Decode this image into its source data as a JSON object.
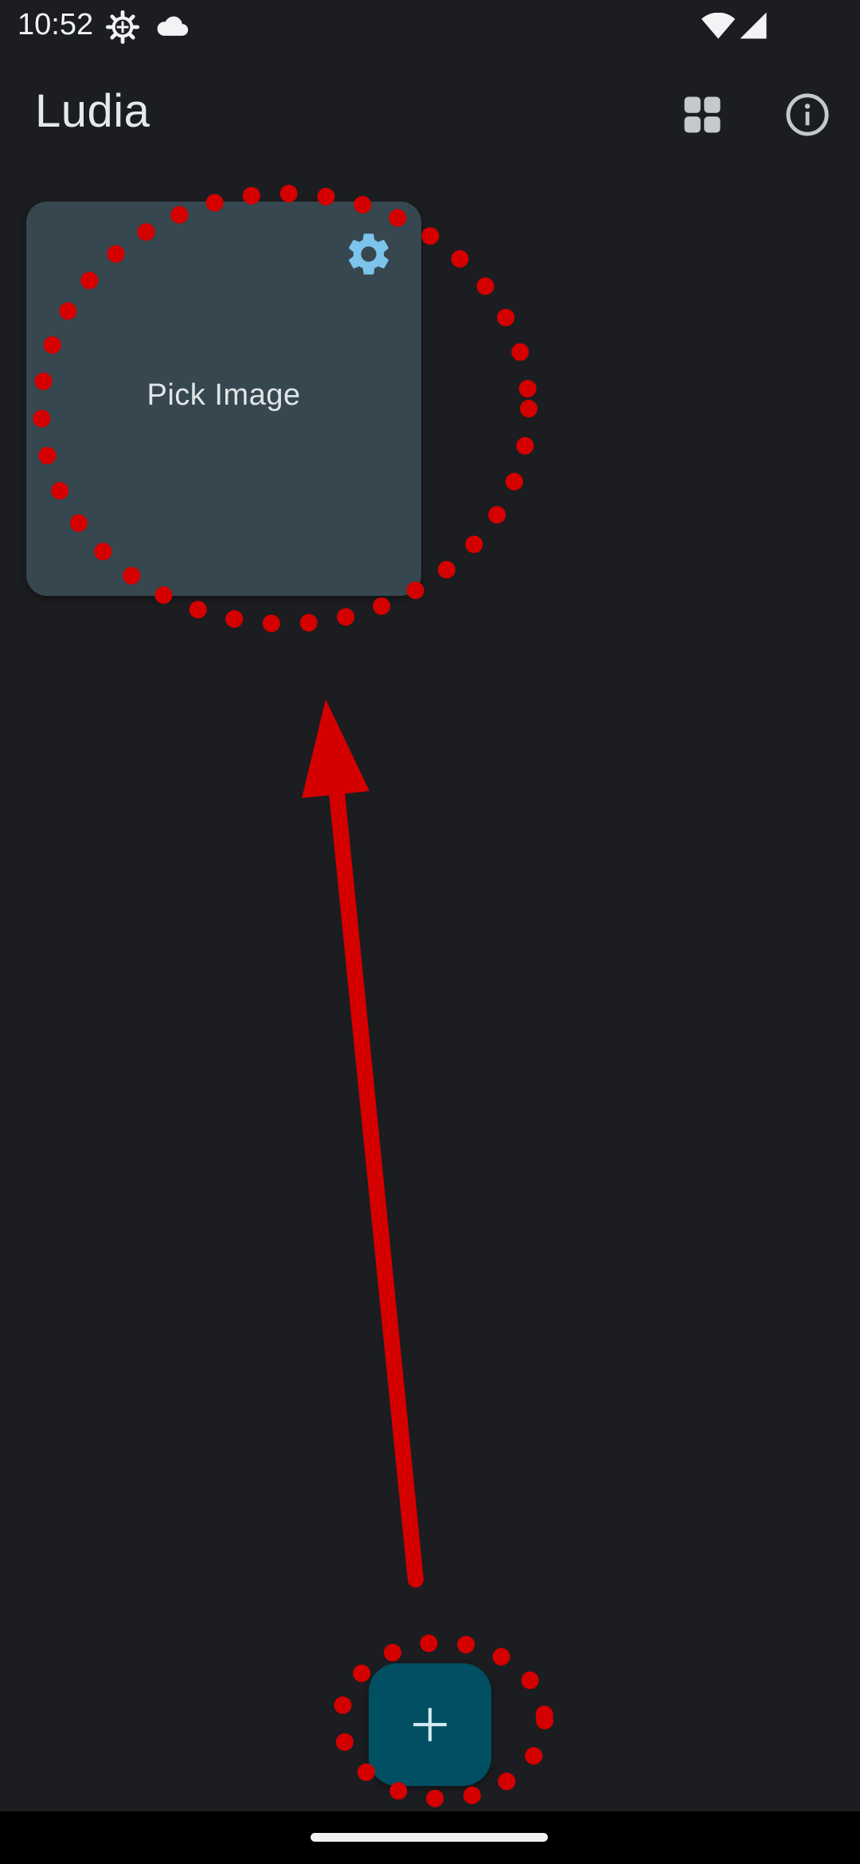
{
  "status_bar": {
    "time": "10:52",
    "icons": [
      "gear-icon",
      "cloud-icon",
      "wifi-icon",
      "cell-signal-icon"
    ]
  },
  "app_bar": {
    "title": "Ludia",
    "actions": [
      "grid-view-icon",
      "info-icon"
    ]
  },
  "card": {
    "label": "Pick Image",
    "icon": "settings-icon",
    "icon_color": "#7cc4ec",
    "background": "#37474f"
  },
  "fab": {
    "icon": "plus-icon",
    "background": "#004f63",
    "icon_color": "#cfe8f1"
  },
  "annotations": {
    "color": "#d40000",
    "shapes": [
      "dotted-circle-around-card",
      "arrow-from-fab-to-card",
      "dotted-circle-around-fab"
    ]
  },
  "colors": {
    "background": "#1b1d20",
    "text": "#e6e9ec"
  }
}
